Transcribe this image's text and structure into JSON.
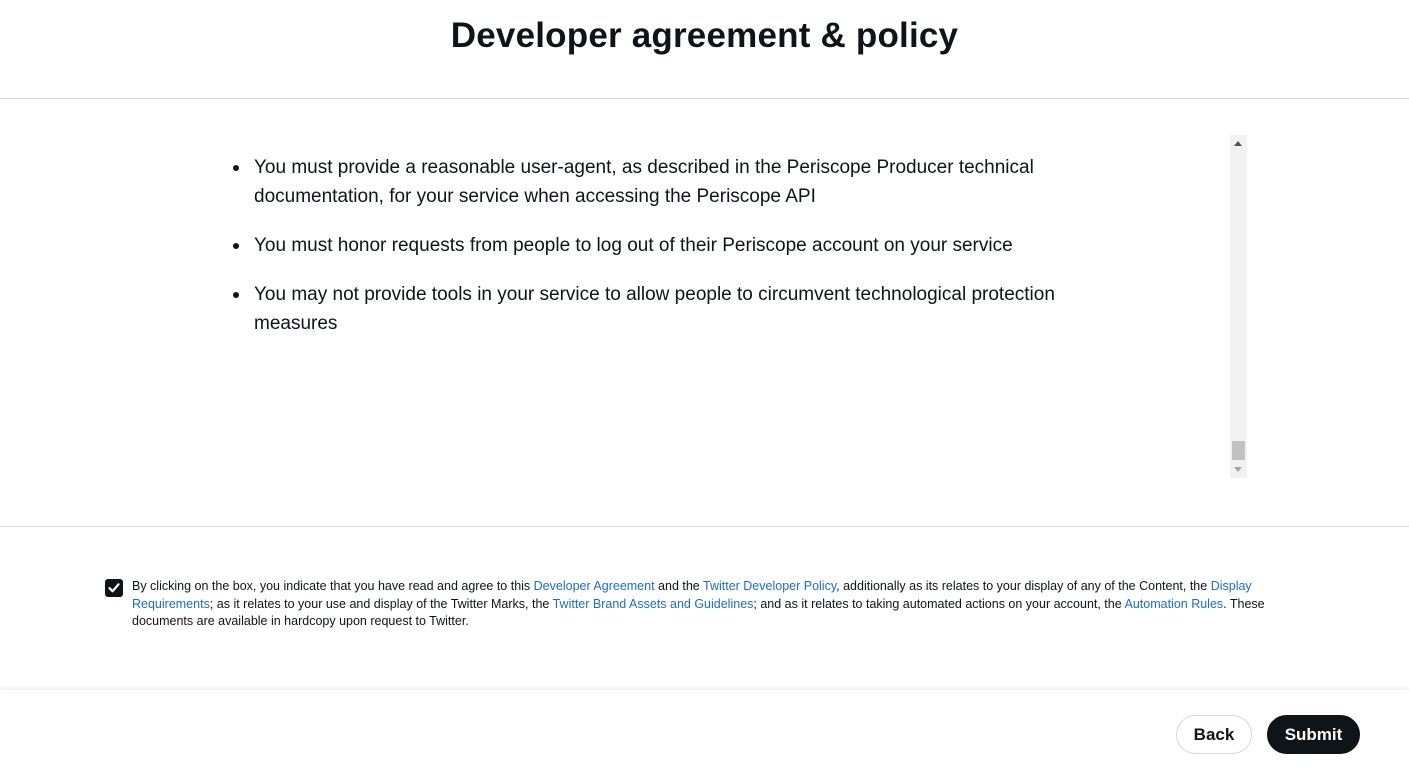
{
  "header": {
    "title": "Developer agreement & policy"
  },
  "policy": {
    "items": [
      {
        "text": "You must provide a reasonable user-agent, as described in the Periscope Producer technical documentation, for your service when accessing the Periscope API"
      },
      {
        "text": "You must honor requests from people to log out of their Periscope account on your service"
      },
      {
        "text": "You may not provide tools in your service to allow people to circumvent technological protection measures"
      }
    ]
  },
  "agreement": {
    "checked": true,
    "text_1": "By clicking on the box, you indicate that you have read and agree to this ",
    "link_developer_agreement": "Developer Agreement",
    "text_2": " and the ",
    "link_developer_policy": "Twitter Developer Policy",
    "text_3": ", additionally as its relates to your display of any of the Content, the ",
    "link_display_requirements": "Display Requirements",
    "text_4": "; as it relates to your use and display of the Twitter Marks, the ",
    "link_brand_assets": "Twitter Brand Assets and Guidelines",
    "text_5": "; and as it relates to taking automated actions on your account, the ",
    "link_automation_rules": "Automation Rules",
    "text_6": ". These documents are available in hardcopy upon request to Twitter."
  },
  "footer": {
    "back_label": "Back",
    "submit_label": "Submit"
  },
  "colors": {
    "text": "#0f1419",
    "link": "#1d6fc4",
    "border": "#cfd9de",
    "primary_button": "#0f1419"
  }
}
